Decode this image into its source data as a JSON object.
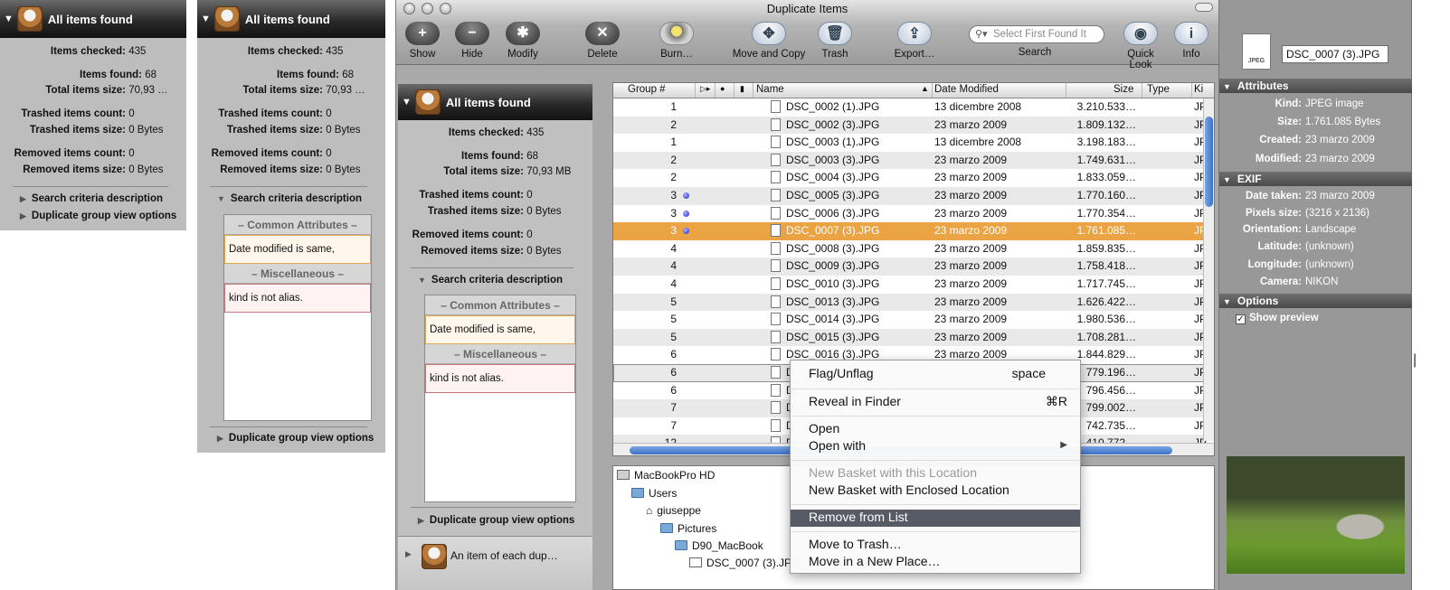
{
  "summary": {
    "header": "All items found",
    "items_checked_label": "Items checked:",
    "items_checked": "435",
    "items_found_label": "Items found:",
    "items_found": "68",
    "total_size_label": "Total items size:",
    "total_size_truncated": "70,93 …",
    "total_size": "70,93 MB",
    "trashed_count_label": "Trashed items count:",
    "trashed_count": "0",
    "trashed_size_label": "Trashed items size:",
    "trashed_size": "0 Bytes",
    "removed_count_label": "Removed items count:",
    "removed_count": "0",
    "removed_size_label": "Removed items size:",
    "removed_size": "0 Bytes",
    "search_criteria": "Search criteria description",
    "view_options": "Duplicate group view options",
    "common_attributes": "– Common Attributes –",
    "date_modified_rule": "Date modified is same,",
    "miscellaneous": "– Miscellaneous –",
    "kind_rule": "kind is not alias."
  },
  "window": {
    "title": "Duplicate Items",
    "toolbar": {
      "show": "Show",
      "hide": "Hide",
      "modify": "Modify",
      "delete": "Delete",
      "burn": "Burn…",
      "move_copy": "Move and Copy",
      "trash": "Trash",
      "export": "Export…",
      "search": "Search",
      "quick_look": "Quick Look",
      "info": "Info",
      "search_placeholder": "Select First Found It"
    },
    "second_basket": "An item of each dup…"
  },
  "table": {
    "columns": [
      "Group #",
      "Name",
      "Date Modified",
      "Size",
      "Type",
      "Ki"
    ],
    "rows": [
      {
        "group": "1",
        "name": "DSC_0002 (1).JPG",
        "date": "13 dicembre 2008",
        "size": "3.210.533…",
        "kind": "JP"
      },
      {
        "group": "2",
        "name": "DSC_0002 (3).JPG",
        "date": "23 marzo 2009",
        "size": "1.809.132…",
        "kind": "JP"
      },
      {
        "group": "1",
        "name": "DSC_0003 (1).JPG",
        "date": "13 dicembre 2008",
        "size": "3.198.183…",
        "kind": "JP"
      },
      {
        "group": "2",
        "name": "DSC_0003 (3).JPG",
        "date": "23 marzo 2009",
        "size": "1.749.631…",
        "kind": "JP"
      },
      {
        "group": "2",
        "name": "DSC_0004 (3).JPG",
        "date": "23 marzo 2009",
        "size": "1.833.059…",
        "kind": "JP"
      },
      {
        "group": "3",
        "name": "DSC_0005 (3).JPG",
        "date": "23 marzo 2009",
        "size": "1.770.160…",
        "kind": "JP",
        "dot": true
      },
      {
        "group": "3",
        "name": "DSC_0006 (3).JPG",
        "date": "23 marzo 2009",
        "size": "1.770.354…",
        "kind": "JP",
        "dot": true
      },
      {
        "group": "3",
        "name": "DSC_0007 (3).JPG",
        "date": "23 marzo 2009",
        "size": "1.761.085…",
        "kind": "JP",
        "dot": true,
        "selected": true
      },
      {
        "group": "4",
        "name": "DSC_0008 (3).JPG",
        "date": "23 marzo 2009",
        "size": "1.859.835…",
        "kind": "JP"
      },
      {
        "group": "4",
        "name": "DSC_0009 (3).JPG",
        "date": "23 marzo 2009",
        "size": "1.758.418…",
        "kind": "JP"
      },
      {
        "group": "4",
        "name": "DSC_0010 (3).JPG",
        "date": "23 marzo 2009",
        "size": "1.717.745…",
        "kind": "JP"
      },
      {
        "group": "5",
        "name": "DSC_0013 (3).JPG",
        "date": "23 marzo 2009",
        "size": "1.626.422…",
        "kind": "JP"
      },
      {
        "group": "5",
        "name": "DSC_0014 (3).JPG",
        "date": "23 marzo 2009",
        "size": "1.980.536…",
        "kind": "JP"
      },
      {
        "group": "5",
        "name": "DSC_0015 (3).JPG",
        "date": "23 marzo 2009",
        "size": "1.708.281…",
        "kind": "JP"
      },
      {
        "group": "6",
        "name": "DSC_0016 (3).JPG",
        "date": "23 marzo 2009",
        "size": "1.844.829…",
        "kind": "JP"
      },
      {
        "group": "6",
        "name": "D",
        "date": "",
        "size": "779.196…",
        "kind": "JP",
        "focus": true
      },
      {
        "group": "6",
        "name": "D",
        "date": "",
        "size": "796.456…",
        "kind": "JP"
      },
      {
        "group": "7",
        "name": "D",
        "date": "",
        "size": "799.002…",
        "kind": "JP"
      },
      {
        "group": "7",
        "name": "D",
        "date": "",
        "size": "742.735…",
        "kind": "JP"
      },
      {
        "group": "12",
        "name": "D",
        "date": "",
        "size": "410.772…",
        "kind": "JP"
      }
    ]
  },
  "path": {
    "disk": "MacBookPro HD",
    "users": "Users",
    "user": "giuseppe",
    "pictures": "Pictures",
    "folder": "D90_MacBook",
    "file": "DSC_0007 (3).JPG"
  },
  "context_menu": {
    "flag": "Flag/Unflag",
    "flag_sc": "space",
    "reveal": "Reveal in Finder",
    "reveal_sc": "⌘R",
    "open": "Open",
    "open_with": "Open with",
    "open_with_arrow": "▶",
    "new_basket_loc": "New Basket with this Location",
    "new_basket_enc": "New Basket with Enclosed Location",
    "remove": "Remove from List",
    "move_trash": "Move to Trash…",
    "move_new": "Move in a New Place…"
  },
  "inspector": {
    "filename": "DSC_0007 (3).JPG",
    "icon_label": "JPEG",
    "attributes": "Attributes",
    "kind_label": "Kind:",
    "kind": "JPEG image",
    "size_label": "Size:",
    "size": "1.761.085 Bytes",
    "created_label": "Created:",
    "created": "23 marzo 2009",
    "modified_label": "Modified:",
    "modified": "23 marzo 2009",
    "exif": "EXIF",
    "date_taken_label": "Date taken:",
    "date_taken": "23 marzo 2009",
    "pixels_label": "Pixels size:",
    "pixels": "(3216 x 2136)",
    "orientation_label": "Orientation:",
    "orientation": "Landscape",
    "latitude_label": "Latitude:",
    "latitude": "(unknown)",
    "longitude_label": "Longitude:",
    "longitude": "(unknown)",
    "camera_label": "Camera:",
    "camera": "NIKON",
    "options": "Options",
    "show_preview": "Show preview"
  }
}
